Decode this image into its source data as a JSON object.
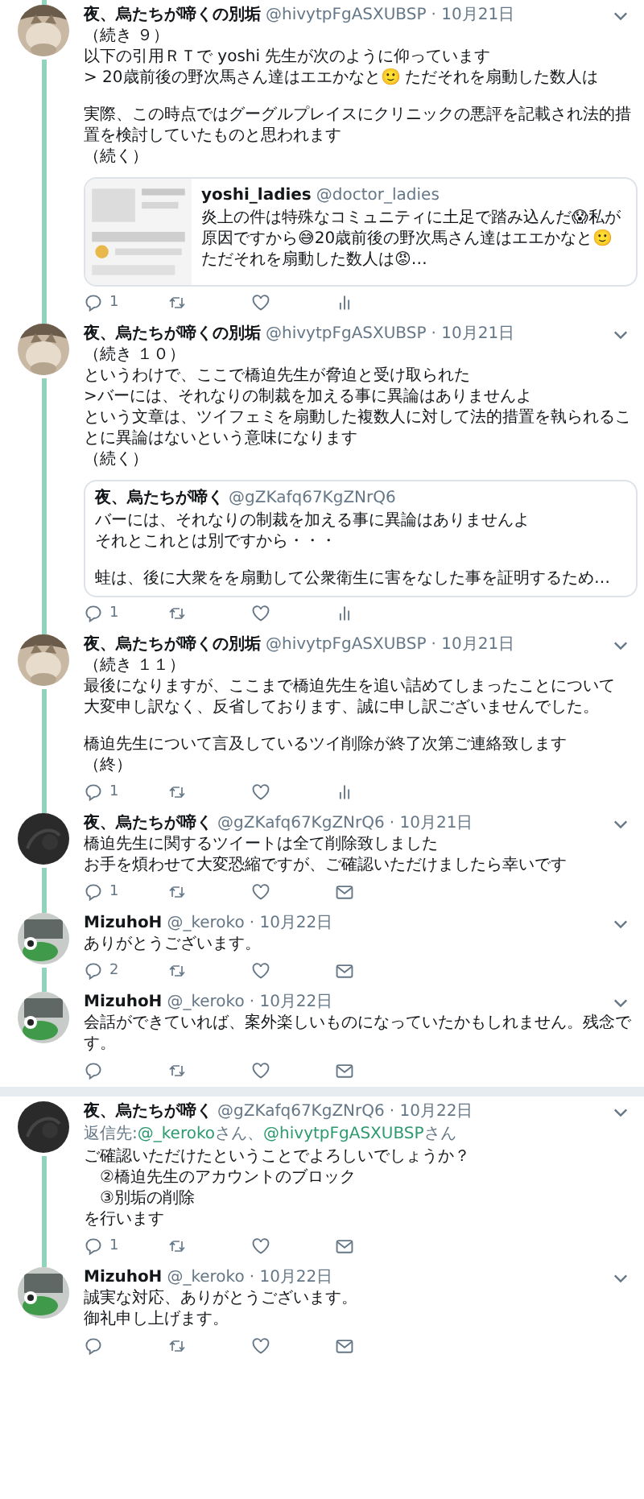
{
  "tweets": [
    {
      "name": "夜、烏たちが啼くの別垢",
      "handle": "@hivytpFgASXUBSP",
      "date": "· 10月21日",
      "thread_above": true,
      "thread_below": true,
      "paragraphs": [
        [
          "（続き ９）",
          "以下の引用ＲＴで yoshi 先生が次のように仰っています",
          "> 20歳前後の野次馬さん達はエエかなと🙂 ただそれを扇動した数人は"
        ],
        [
          "実際、この時点ではグーグルプレイスにクリニックの悪評を記載され法的措置を検討していたものと思われます",
          "（続く）"
        ]
      ],
      "quote": {
        "thumbnail": true,
        "name": "yoshi_ladies",
        "handle": "@doctor_ladies",
        "paragraphs": [
          [
            "炎上の件は特殊なコミュニティに土足で踏み込んだ😱私が原因ですから😅20歳前後の野次馬さん達はエエかなと🙂",
            "ただそれを扇動した数人は😡…"
          ]
        ]
      },
      "actions": [
        {
          "kind": "reply",
          "count": "1"
        },
        {
          "kind": "retweet"
        },
        {
          "kind": "like"
        },
        {
          "kind": "analytics"
        }
      ]
    },
    {
      "name": "夜、烏たちが啼くの別垢",
      "handle": "@hivytpFgASXUBSP",
      "date": "· 10月21日",
      "thread_above": true,
      "thread_below": true,
      "paragraphs": [
        [
          "（続き １０）",
          "というわけで、ここで橋迫先生が脅迫と受け取られた",
          ">バーには、それなりの制裁を加える事に異論はありませんよ",
          "という文章は、ツイフェミを扇動した複数人に対して法的措置を執られることに異論はないという意味になります",
          "（続く）"
        ]
      ],
      "quote": {
        "thumbnail": false,
        "name": "夜、烏たちが啼く",
        "handle": "@gZKafq67KgZNrQ6",
        "paragraphs": [
          [
            "バーには、それなりの制裁を加える事に異論はありませんよ",
            "それとこれとは別ですから・・・"
          ],
          [
            "蛙は、後に大衆をを扇動して公衆衛生に害をなした事を証明するため…"
          ]
        ]
      },
      "actions": [
        {
          "kind": "reply",
          "count": "1"
        },
        {
          "kind": "retweet"
        },
        {
          "kind": "like"
        },
        {
          "kind": "analytics"
        }
      ]
    },
    {
      "name": "夜、烏たちが啼くの別垢",
      "handle": "@hivytpFgASXUBSP",
      "date": "· 10月21日",
      "thread_above": true,
      "thread_below": true,
      "paragraphs": [
        [
          "（続き １１）",
          "最後になりますが、ここまで橋迫先生を追い詰めてしまったことについて",
          "大変申し訳なく、反省しております、誠に申し訳ございませんでした。"
        ],
        [
          "橋迫先生について言及しているツイ削除が終了次第ご連絡致します",
          "（終）"
        ]
      ],
      "actions": [
        {
          "kind": "reply",
          "count": "1"
        },
        {
          "kind": "retweet"
        },
        {
          "kind": "like"
        },
        {
          "kind": "analytics"
        }
      ]
    },
    {
      "name": "夜、烏たちが啼く",
      "handle": "@gZKafq67KgZNrQ6",
      "date": "· 10月21日",
      "thread_above": true,
      "thread_below": true,
      "paragraphs": [
        [
          "橋迫先生に関するツイートは全て削除致しました",
          "お手を煩わせて大変恐縮ですが、ご確認いただけましたら幸いです"
        ]
      ],
      "actions": [
        {
          "kind": "reply",
          "count": "1"
        },
        {
          "kind": "retweet"
        },
        {
          "kind": "like"
        },
        {
          "kind": "mail"
        }
      ]
    },
    {
      "name": "MizuhoH",
      "handle": "@_keroko",
      "date": "· 10月22日",
      "thread_above": true,
      "thread_below": true,
      "paragraphs": [
        [
          "ありがとうございます。"
        ]
      ],
      "actions": [
        {
          "kind": "reply",
          "count": "2"
        },
        {
          "kind": "retweet"
        },
        {
          "kind": "like"
        },
        {
          "kind": "mail"
        }
      ]
    },
    {
      "name": "MizuhoH",
      "handle": "@_keroko",
      "date": "· 10月22日",
      "thread_above": true,
      "thread_below": false,
      "paragraphs": [
        [
          "会話ができていれば、案外楽しいものになっていたかもしれません。残念です。"
        ]
      ],
      "actions": [
        {
          "kind": "reply"
        },
        {
          "kind": "retweet"
        },
        {
          "kind": "like"
        },
        {
          "kind": "mail"
        }
      ]
    },
    {
      "name": "夜、烏たちが啼く",
      "handle": "@gZKafq67KgZNrQ6",
      "date": "· 10月22日",
      "thread_above": false,
      "thread_below": true,
      "reply_to": {
        "prefix": "返信先:",
        "mentions": [
          {
            "name": "@_keroko",
            "suffix": "さん、"
          },
          {
            "name": "@hivytpFgASXUBSP",
            "suffix": "さん"
          }
        ]
      },
      "paragraphs": [
        [
          "ご確認いただけたということでよろしいでしょうか？",
          "　②橋迫先生のアカウントのブロック",
          "　③別垢の削除",
          "を行います"
        ]
      ],
      "actions": [
        {
          "kind": "reply",
          "count": "1"
        },
        {
          "kind": "retweet"
        },
        {
          "kind": "like"
        },
        {
          "kind": "mail"
        }
      ]
    },
    {
      "name": "MizuhoH",
      "handle": "@_keroko",
      "date": "· 10月22日",
      "thread_above": true,
      "thread_below": false,
      "paragraphs": [
        [
          "誠実な対応、ありがとうございます。",
          "御礼申し上げます。"
        ]
      ],
      "actions": [
        {
          "kind": "reply"
        },
        {
          "kind": "retweet"
        },
        {
          "kind": "like"
        },
        {
          "kind": "mail"
        }
      ]
    }
  ]
}
